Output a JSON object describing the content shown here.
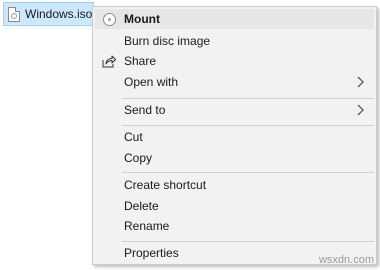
{
  "file": {
    "name": "Windows.iso",
    "icon": "disc-image-file-icon"
  },
  "menu": {
    "items": [
      {
        "label": "Mount",
        "icon": "disc-icon",
        "default": true
      },
      {
        "label": "Burn disc image"
      },
      {
        "label": "Share",
        "icon": "share-icon"
      },
      {
        "label": "Open with",
        "submenu": true
      },
      {
        "label": "Send to",
        "submenu": true
      },
      {
        "label": "Cut"
      },
      {
        "label": "Copy"
      },
      {
        "label": "Create shortcut"
      },
      {
        "label": "Delete"
      },
      {
        "label": "Rename"
      },
      {
        "label": "Properties"
      }
    ]
  },
  "watermark": "wsxdn.com",
  "colors": {
    "selection": "#cce8ff",
    "menu_bg": "#f2f2f2",
    "default_item_bg": "#e6e6e6"
  }
}
